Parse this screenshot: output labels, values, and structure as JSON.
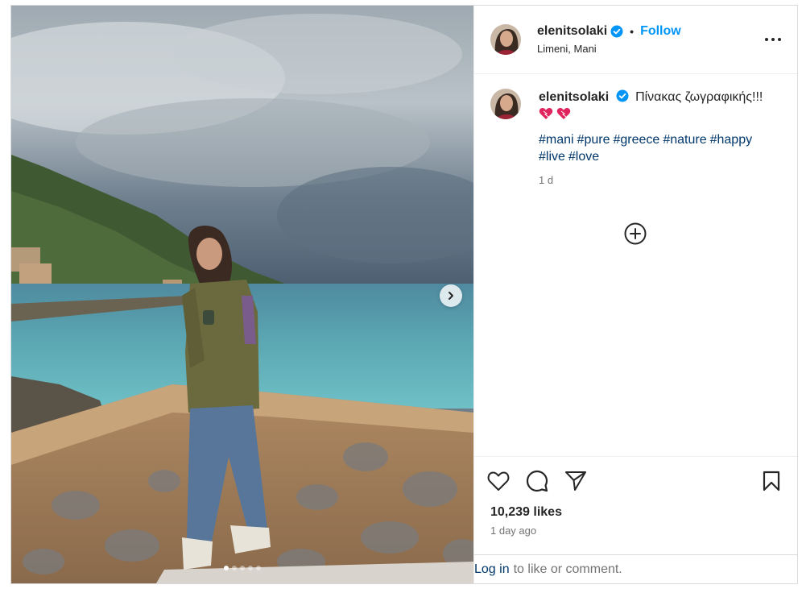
{
  "post": {
    "username": "elenitsolaki",
    "location": "Limeni, Mani",
    "follow_label": "Follow",
    "separator": "•",
    "caption_text": "Πίνακας ζωγραφικής!!!",
    "caption_emojis": [
      "heart-icon",
      "heart-icon"
    ],
    "hashtags": [
      "#mani",
      "#pure",
      "#greece",
      "#nature",
      "#happy",
      "#live",
      "#love"
    ],
    "caption_time": "1 d",
    "likes": "10,239 likes",
    "date": "1 day ago",
    "login_link": "Log in",
    "login_suffix": "to like or comment.",
    "carousel": {
      "slides": 5,
      "active": 1
    },
    "colors": {
      "accent": "#0095f6",
      "hashtag": "#00376b",
      "heart": "#e0245e",
      "verified": "#0095f6"
    },
    "icons": [
      "verified-badge-icon",
      "more-options-icon",
      "load-more-comments-icon",
      "like-icon",
      "comment-icon",
      "share-icon",
      "save-icon",
      "carousel-next-icon"
    ]
  }
}
